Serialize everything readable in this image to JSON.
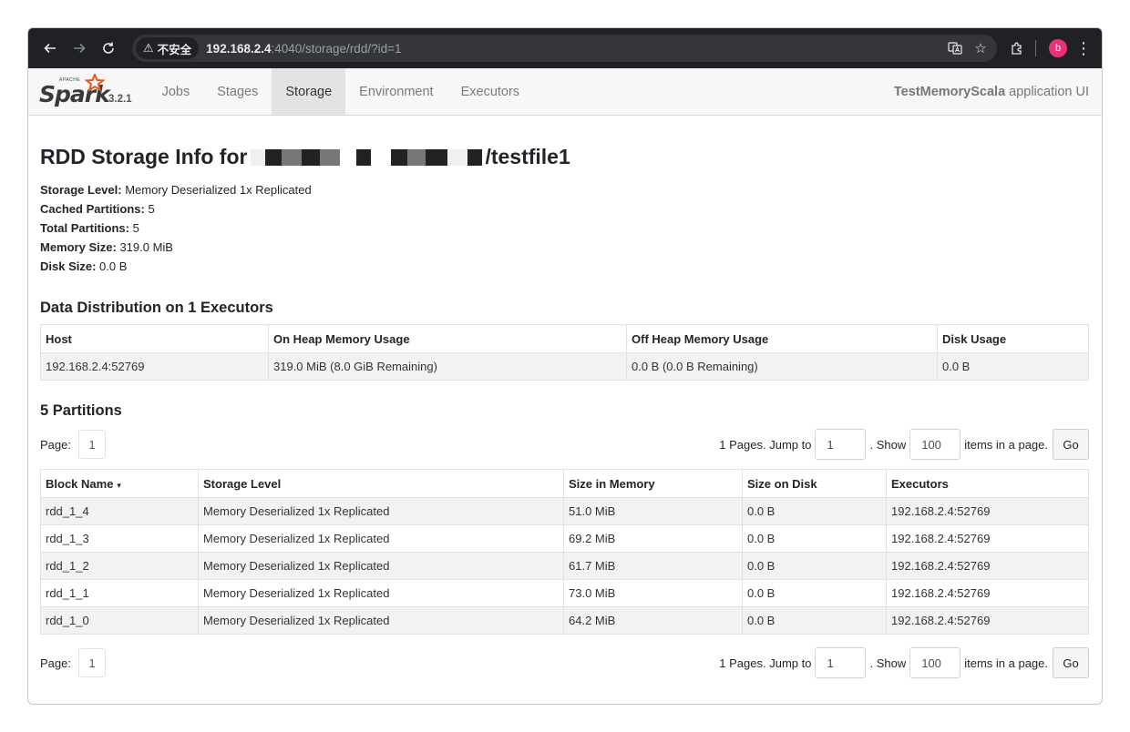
{
  "browser": {
    "insecure_label": "不安全",
    "url_host": "192.168.2.4",
    "url_rest": ":4040/storage/rdd/?id=1",
    "profile_initial": "b"
  },
  "nav": {
    "brand_apache": "APACHE",
    "brand_name": "Spark",
    "version": "3.2.1",
    "tabs": [
      "Jobs",
      "Stages",
      "Storage",
      "Environment",
      "Executors"
    ],
    "active_tab": "Storage",
    "app_name": "TestMemoryScala",
    "app_suffix": "application UI"
  },
  "page": {
    "title_prefix": "RDD Storage Info for",
    "title_suffix": "/testfile1"
  },
  "summary": [
    {
      "label": "Storage Level:",
      "value": "Memory Deserialized 1x Replicated"
    },
    {
      "label": "Cached Partitions:",
      "value": "5"
    },
    {
      "label": "Total Partitions:",
      "value": "5"
    },
    {
      "label": "Memory Size:",
      "value": "319.0 MiB"
    },
    {
      "label": "Disk Size:",
      "value": "0.0 B"
    }
  ],
  "distribution": {
    "heading": "Data Distribution on 1 Executors",
    "columns": [
      "Host",
      "On Heap Memory Usage",
      "Off Heap Memory Usage",
      "Disk Usage"
    ],
    "rows": [
      [
        "192.168.2.4:52769",
        "319.0 MiB (8.0 GiB Remaining)",
        "0.0 B (0.0 B Remaining)",
        "0.0 B"
      ]
    ]
  },
  "partitions": {
    "heading": "5 Partitions",
    "pager": {
      "page_label": "Page:",
      "current_page": "1",
      "pages_text": "1 Pages. Jump to",
      "jump_value": "1",
      "show_text": ". Show",
      "show_value": "100",
      "items_text": "items in a page.",
      "go_label": "Go"
    },
    "columns": [
      "Block Name",
      "Storage Level",
      "Size in Memory",
      "Size on Disk",
      "Executors"
    ],
    "sort_indicator": "▾",
    "rows": [
      [
        "rdd_1_4",
        "Memory Deserialized 1x Replicated",
        "51.0 MiB",
        "0.0 B",
        "192.168.2.4:52769"
      ],
      [
        "rdd_1_3",
        "Memory Deserialized 1x Replicated",
        "69.2 MiB",
        "0.0 B",
        "192.168.2.4:52769"
      ],
      [
        "rdd_1_2",
        "Memory Deserialized 1x Replicated",
        "61.7 MiB",
        "0.0 B",
        "192.168.2.4:52769"
      ],
      [
        "rdd_1_1",
        "Memory Deserialized 1x Replicated",
        "73.0 MiB",
        "0.0 B",
        "192.168.2.4:52769"
      ],
      [
        "rdd_1_0",
        "Memory Deserialized 1x Replicated",
        "64.2 MiB",
        "0.0 B",
        "192.168.2.4:52769"
      ]
    ]
  }
}
